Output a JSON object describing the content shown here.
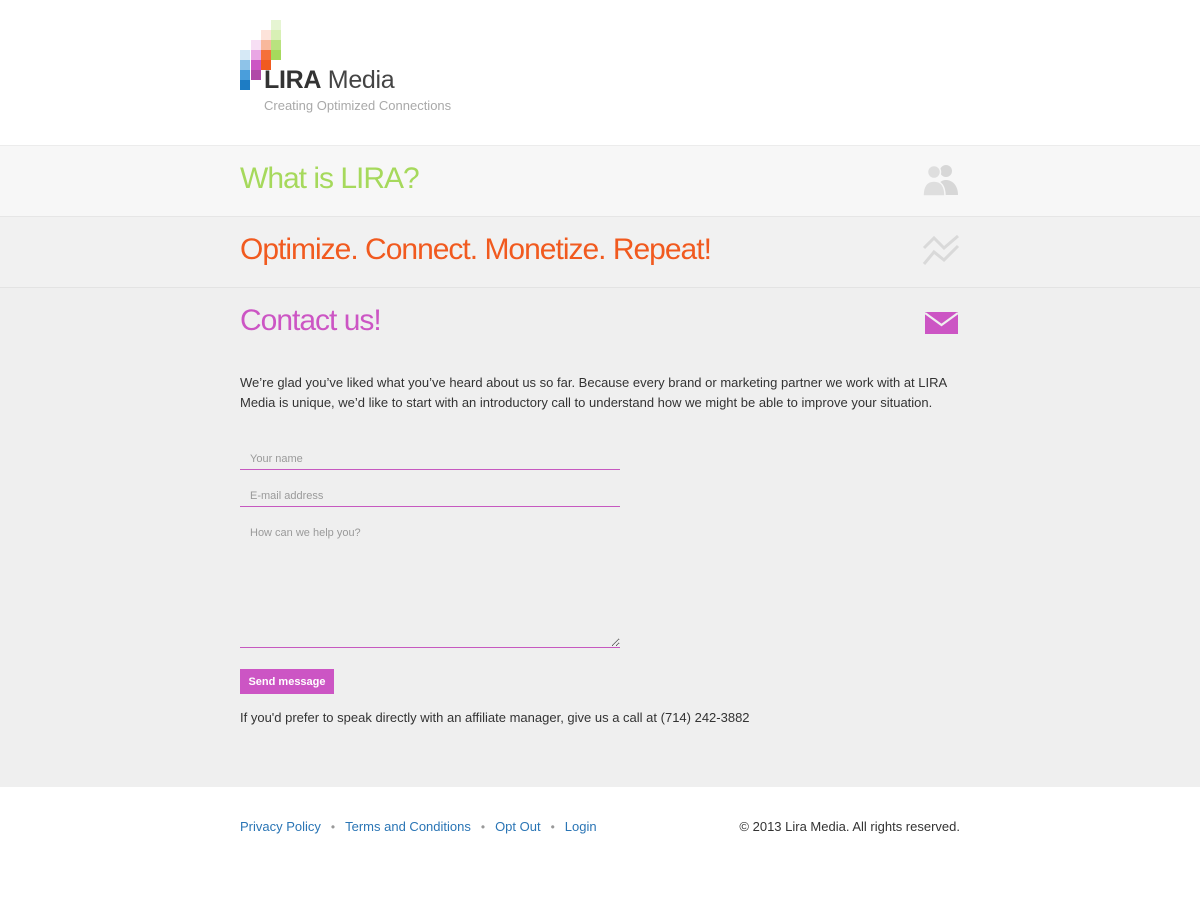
{
  "brand": {
    "name_bold": "LIRA",
    "name_light": "Media",
    "tagline": "Creating Optimized Connections",
    "colors": {
      "green": "#a6d95c",
      "orange": "#f15a1f",
      "purple": "#cc55c4",
      "link": "#2a75b5"
    }
  },
  "sections": [
    {
      "title": "What is LIRA?",
      "icon": "users-icon"
    },
    {
      "title": "Optimize. Connect. Monetize. Repeat!",
      "icon": "trend-chart-icon"
    },
    {
      "title": "Contact us!",
      "icon": "envelope-icon"
    }
  ],
  "contact": {
    "intro": "We’re glad you’ve liked what you’ve heard about us so far. Because every brand or marketing partner we work with at LIRA Media is unique, we’d like to start with an introductory call to understand how we might be able to improve your situation.",
    "name_placeholder": "Your name",
    "email_placeholder": "E-mail address",
    "message_placeholder": "How can we help you?",
    "send_label": "Send message",
    "call_note": "If you'd prefer to speak directly with an affiliate manager, give us a call at (714) 242-3882"
  },
  "footer": {
    "links": [
      {
        "label": "Privacy Policy"
      },
      {
        "label": "Terms and Conditions"
      },
      {
        "label": "Opt Out"
      },
      {
        "label": "Login"
      }
    ],
    "separator": "•",
    "copyright": "© 2013 Lira Media. All rights reserved."
  }
}
